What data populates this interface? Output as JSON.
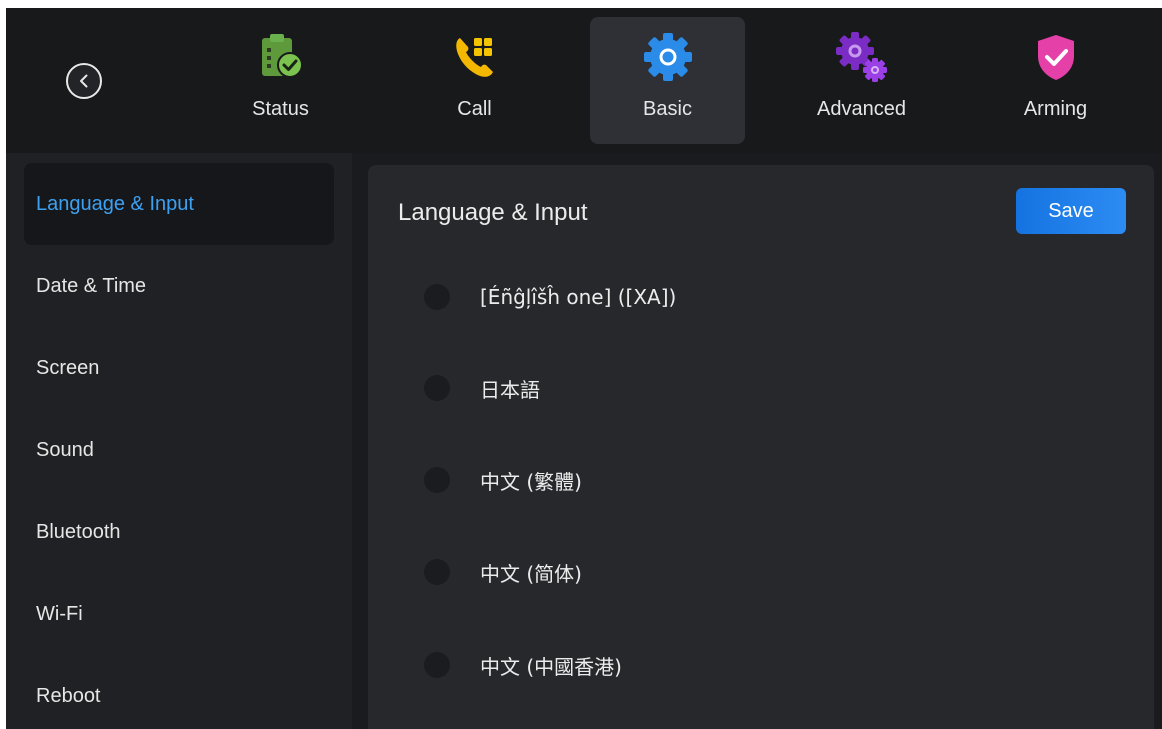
{
  "nav": {
    "tabs": [
      {
        "label": "Status",
        "icon": "clipboard-check-icon",
        "color": "#6ab04c"
      },
      {
        "label": "Call",
        "icon": "phone-keypad-icon",
        "color": "#f5b800"
      },
      {
        "label": "Basic",
        "icon": "gear-icon",
        "color": "#2a8be8",
        "active": true
      },
      {
        "label": "Advanced",
        "icon": "gears-icon",
        "color": "#8a2fd6"
      },
      {
        "label": "Arming",
        "icon": "shield-check-icon",
        "color": "#e53fa8"
      }
    ]
  },
  "sidebar": {
    "items": [
      {
        "label": "Language & Input",
        "active": true
      },
      {
        "label": "Date & Time"
      },
      {
        "label": "Screen"
      },
      {
        "label": "Sound"
      },
      {
        "label": "Bluetooth"
      },
      {
        "label": "Wi-Fi"
      },
      {
        "label": "Reboot"
      }
    ]
  },
  "main": {
    "title": "Language & Input",
    "save_label": "Save",
    "languages": [
      {
        "label": "[Éñĝļîšĥ one] ([XA])"
      },
      {
        "label": "日本語"
      },
      {
        "label": "中文 (繁體)"
      },
      {
        "label": "中文 (简体)"
      },
      {
        "label": "中文 (中國香港)"
      }
    ]
  },
  "colors": {
    "accent": "#3da1f2",
    "save_button": "#1e7fe8",
    "background": "#1a1b1e"
  }
}
